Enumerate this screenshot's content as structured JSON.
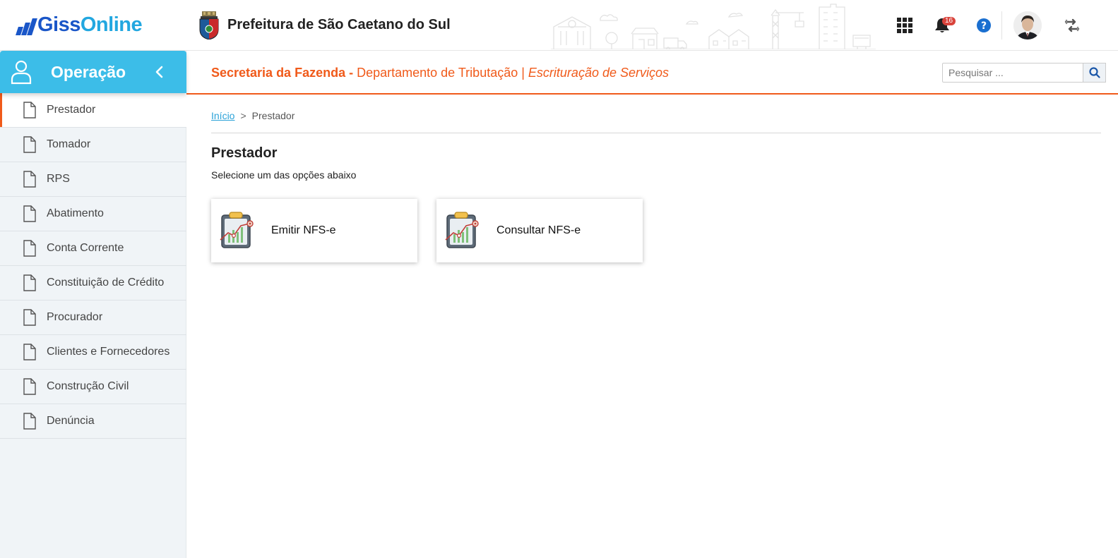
{
  "header": {
    "logo": {
      "part1": "Giss",
      "part2": "Online"
    },
    "city_title": "Prefeitura de São Caetano do Sul",
    "notifications_count": "16",
    "icons": [
      "apps-grid-icon",
      "bell-icon",
      "help-icon",
      "avatar",
      "switch-arrows-icon"
    ]
  },
  "sidebar": {
    "title": "Operação",
    "items": [
      {
        "label": "Prestador",
        "active": true
      },
      {
        "label": "Tomador"
      },
      {
        "label": "RPS"
      },
      {
        "label": "Abatimento"
      },
      {
        "label": "Conta Corrente"
      },
      {
        "label": "Constituição de Crédito"
      },
      {
        "label": "Procurador"
      },
      {
        "label": "Clientes e Fornecedores"
      },
      {
        "label": "Construção Civil"
      },
      {
        "label": "Denúncia"
      }
    ]
  },
  "subheader": {
    "secretaria": "Secretaria da Fazenda - ",
    "departamento": "Departamento de Tributação | ",
    "escrituracao": "Escrituração de Serviços",
    "search_placeholder": "Pesquisar ..."
  },
  "breadcrumb": {
    "home": "Início",
    "separator": ">",
    "current": "Prestador"
  },
  "main": {
    "title": "Prestador",
    "subtitle": "Selecione um das opções abaixo",
    "cards": [
      {
        "label": "Emitir NFS-e"
      },
      {
        "label": "Consultar NFS-e"
      }
    ]
  },
  "colors": {
    "accent_orange": "#f05a1a",
    "sidebar_header": "#3cbde8",
    "brand_blue": "#1a56c8",
    "badge_red": "#d9433b"
  }
}
